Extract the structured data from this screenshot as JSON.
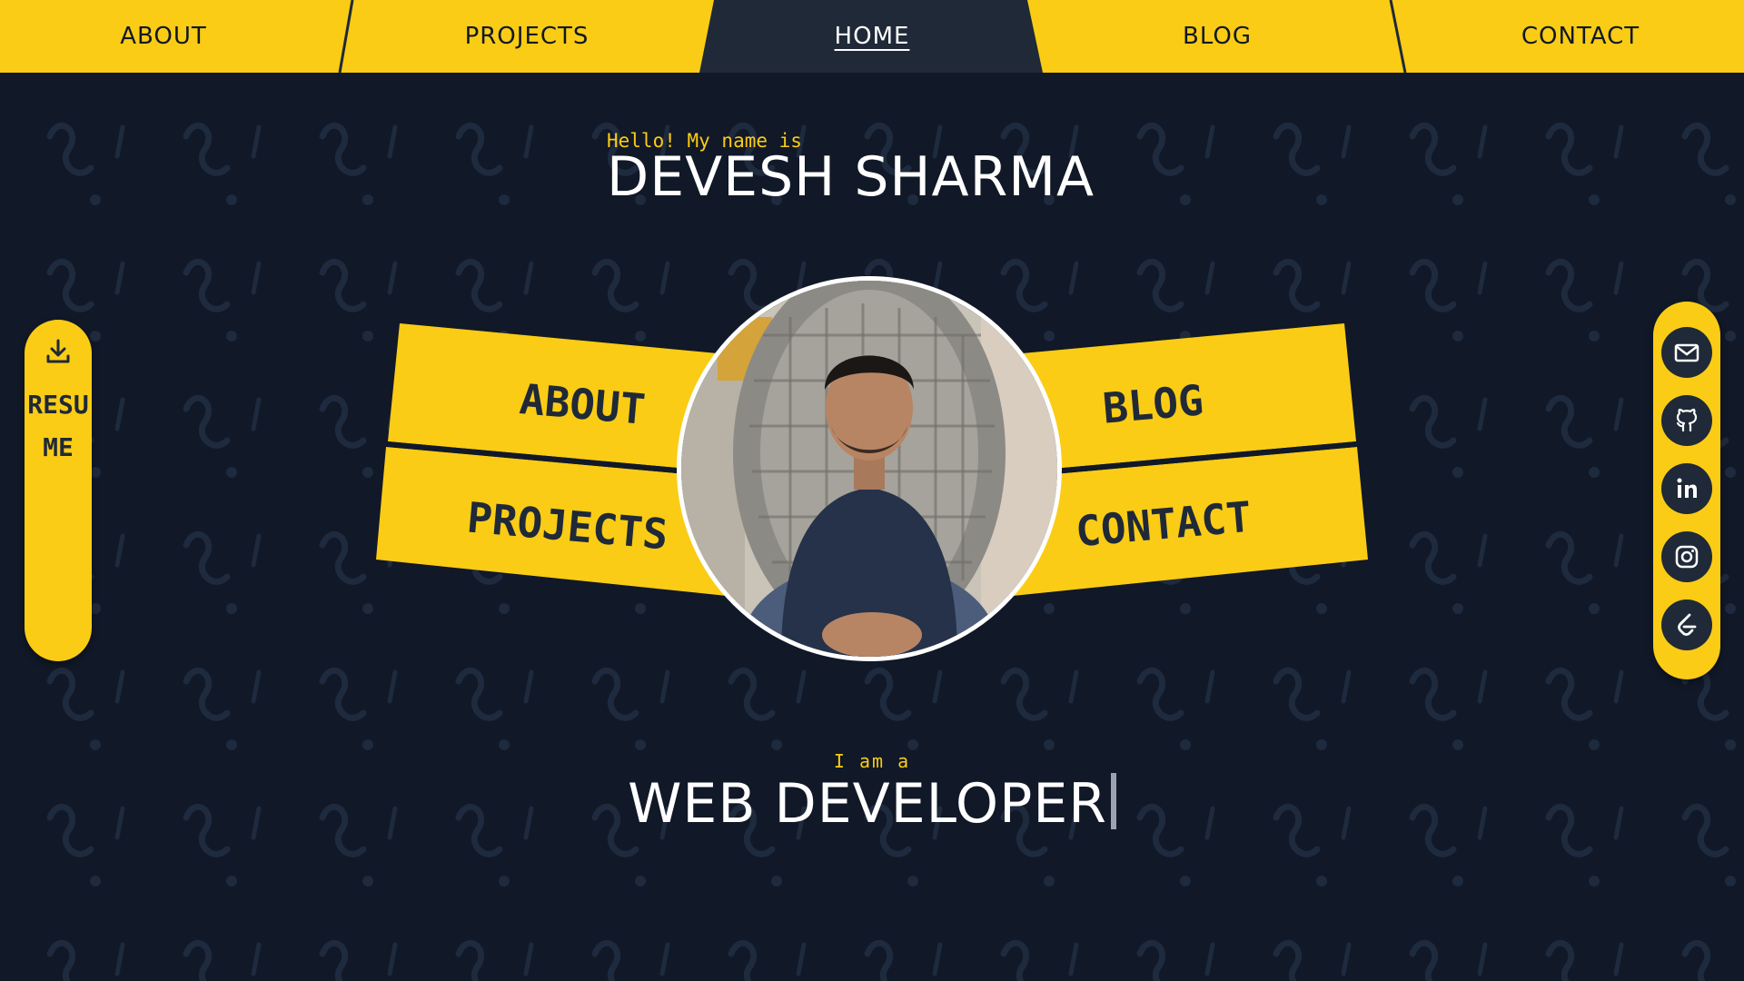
{
  "nav": {
    "items": [
      {
        "label": "ABOUT",
        "active": false
      },
      {
        "label": "PROJECTS",
        "active": false
      },
      {
        "label": "HOME",
        "active": true
      },
      {
        "label": "BLOG",
        "active": false
      },
      {
        "label": "CONTACT",
        "active": false
      }
    ]
  },
  "hero": {
    "greeting": "Hello! My name is",
    "name": "DEVESH SHARMA"
  },
  "hub": {
    "about_label": "ABOUT",
    "projects_label": "PROJECTS",
    "blog_label": "BLOG",
    "contact_label": "CONTACT"
  },
  "role": {
    "intro": "I am a",
    "title": "WEB DEVELOPER"
  },
  "resume": {
    "label": "RESUME",
    "icon": "download-icon"
  },
  "social": [
    {
      "icon": "mail-icon"
    },
    {
      "icon": "github-icon"
    },
    {
      "icon": "linkedin-icon"
    },
    {
      "icon": "instagram-icon"
    },
    {
      "icon": "leetcode-icon"
    }
  ],
  "colors": {
    "accent": "#facc15",
    "background": "#111827",
    "panel_text": "#1f2937",
    "nav_active_bg": "#1f2937",
    "heading_text": "#ffffff"
  }
}
